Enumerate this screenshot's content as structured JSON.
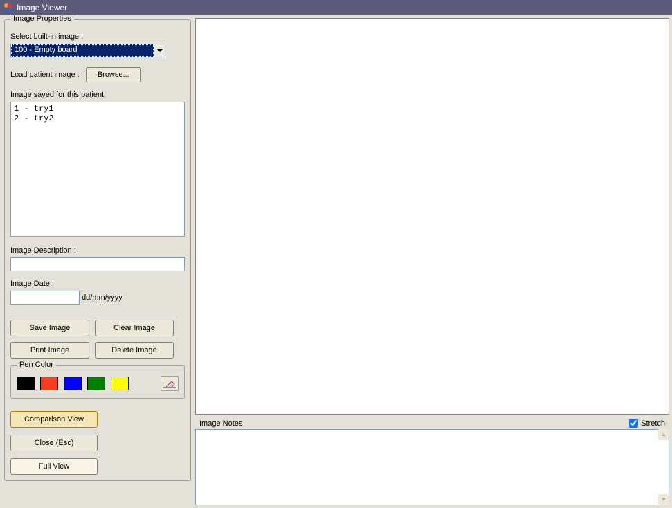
{
  "window": {
    "title": "Image Viewer"
  },
  "properties": {
    "group_title": "Image Properties",
    "select_label": "Select built-in image :",
    "select_value": "100 - Empty board",
    "load_label": "Load patient image :",
    "browse_label": "Browse...",
    "saved_label": "Image saved for this patient:",
    "saved_list": [
      "1 - try1",
      "2 - try2"
    ],
    "desc_label": "Image Description :",
    "desc_value": "",
    "date_label": "Image Date :",
    "date_value": "",
    "date_format": "dd/mm/yyyy",
    "btn_save": "Save Image",
    "btn_clear": "Clear Image",
    "btn_print": "Print Image",
    "btn_delete": "Delete Image"
  },
  "pen": {
    "group_title": "Pen Color",
    "colors": [
      "#000000",
      "#fa3c1e",
      "#0000ff",
      "#008000",
      "#ffff00"
    ]
  },
  "bottom": {
    "comparison": "Comparison View",
    "close": "Close (Esc)",
    "full": "Full View"
  },
  "notes": {
    "label": "Image Notes",
    "stretch_label": "Stretch",
    "stretch_checked": true,
    "value": ""
  }
}
